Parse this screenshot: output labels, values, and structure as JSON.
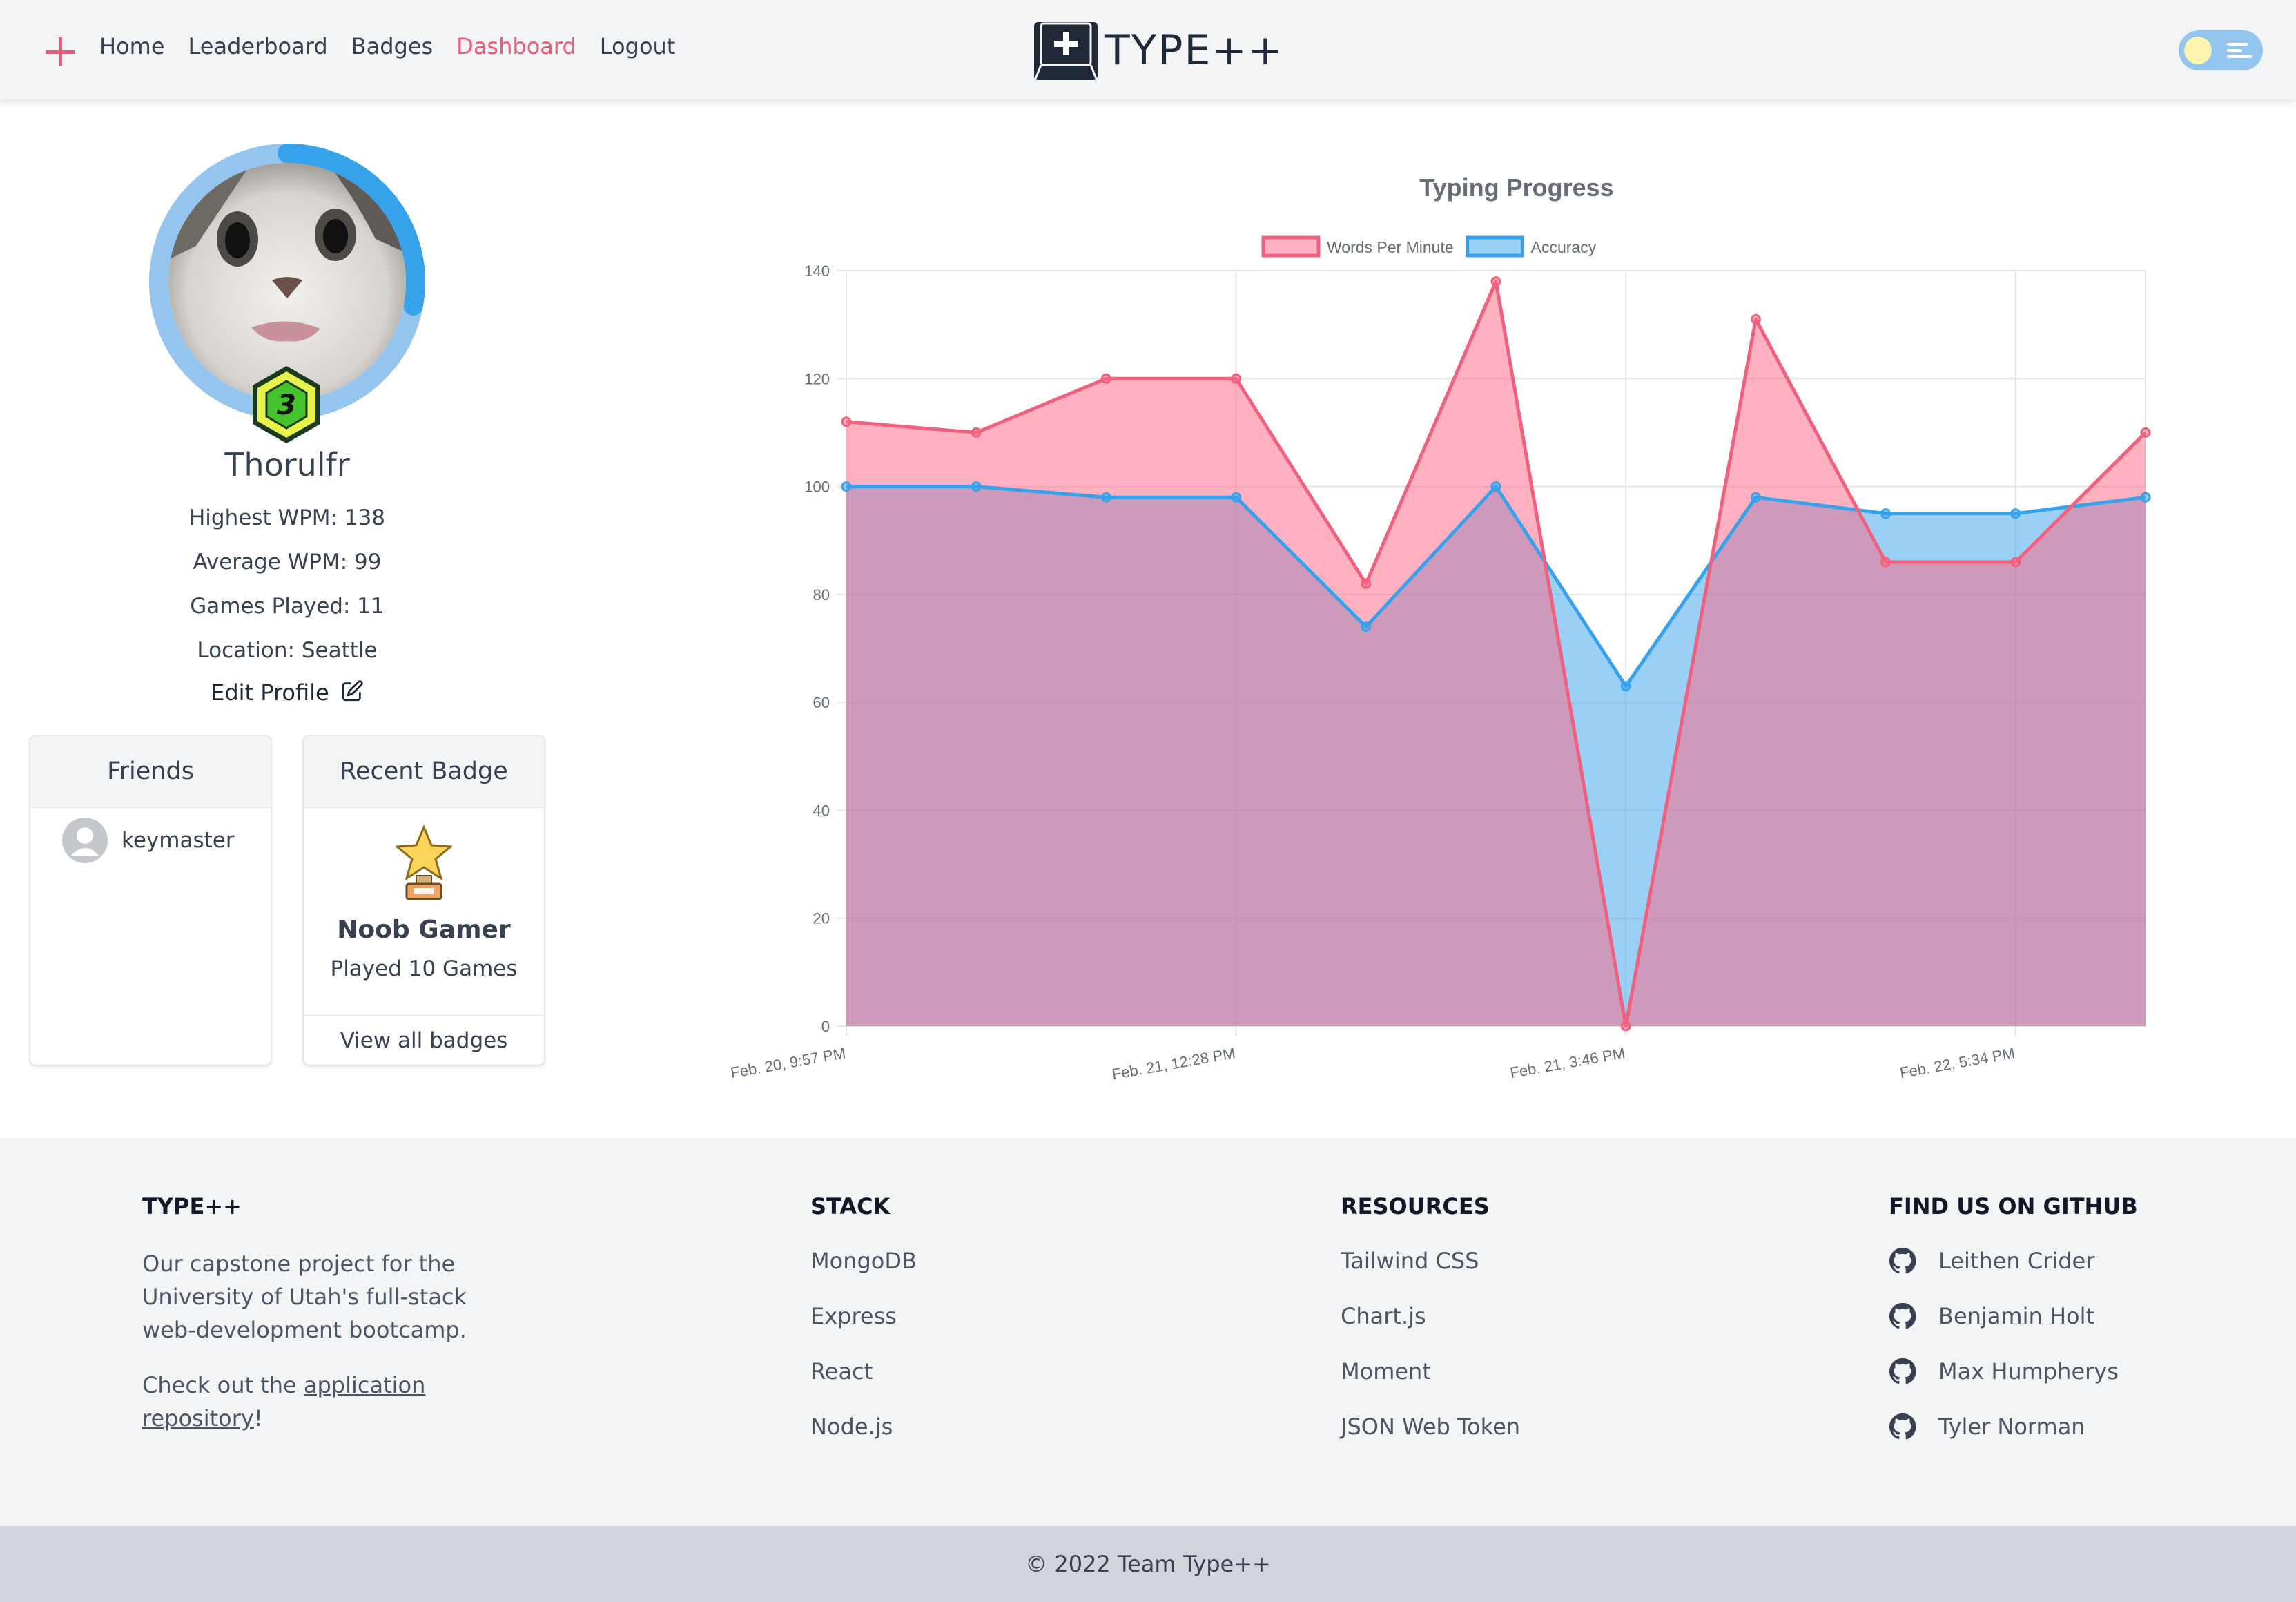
{
  "nav": {
    "links": [
      {
        "label": "Home",
        "active": false
      },
      {
        "label": "Leaderboard",
        "active": false
      },
      {
        "label": "Badges",
        "active": false
      },
      {
        "label": "Dashboard",
        "active": true
      },
      {
        "label": "Logout",
        "active": false
      }
    ],
    "logo_text": "TYPE++",
    "accent_color": "#f05a78"
  },
  "profile": {
    "username": "Thorulfr",
    "level": "3",
    "level_progress": 0.28,
    "highest_wpm": "Highest WPM: 138",
    "average_wpm": "Average WPM: 99",
    "games_played": "Games Played: 11",
    "location": "Location: Seattle",
    "edit_label": "Edit Profile"
  },
  "friends": {
    "title": "Friends",
    "items": [
      {
        "name": "keymaster"
      }
    ]
  },
  "recent_badge": {
    "title": "Recent Badge",
    "name": "Noob Gamer",
    "description": "Played 10 Games",
    "link": "View all badges"
  },
  "chart_data": {
    "type": "area",
    "title": "Typing Progress",
    "legend_position": "top",
    "x_tick_labels": [
      "Feb. 20, 9:57 PM",
      "Feb. 21, 12:28 PM",
      "Feb. 21, 3:46 PM",
      "Feb. 22, 5:34 PM"
    ],
    "ylim": [
      0,
      140
    ],
    "y_ticks": [
      0,
      20,
      40,
      60,
      80,
      100,
      120,
      140
    ],
    "grid": true,
    "series": [
      {
        "name": "Words Per Minute",
        "color": "#f0607f",
        "fill": "rgba(255,99,132,0.5)",
        "values": [
          112,
          110,
          120,
          120,
          82,
          138,
          0,
          131,
          86,
          86,
          110
        ]
      },
      {
        "name": "Accuracy",
        "color": "#36a2eb",
        "fill": "rgba(54,162,235,0.5)",
        "values": [
          100,
          100,
          98,
          98,
          74,
          100,
          63,
          98,
          95,
          95,
          98
        ]
      }
    ]
  },
  "footer": {
    "about": {
      "title": "TYPE++",
      "text": "Our capstone project for the University of Utah's full-stack web-development bootcamp.",
      "check_prefix": "Check out the ",
      "check_link": "application repository",
      "check_suffix": "!"
    },
    "stack": {
      "title": "STACK",
      "items": [
        "MongoDB",
        "Express",
        "React",
        "Node.js"
      ]
    },
    "resources": {
      "title": "RESOURCES",
      "items": [
        "Tailwind CSS",
        "Chart.js",
        "Moment",
        "JSON Web Token"
      ]
    },
    "github": {
      "title": "FIND US ON GITHUB",
      "items": [
        "Leithen Crider",
        "Benjamin Holt",
        "Max Humpherys",
        "Tyler Norman"
      ]
    },
    "copyright": "© 2022 Team Type++"
  }
}
